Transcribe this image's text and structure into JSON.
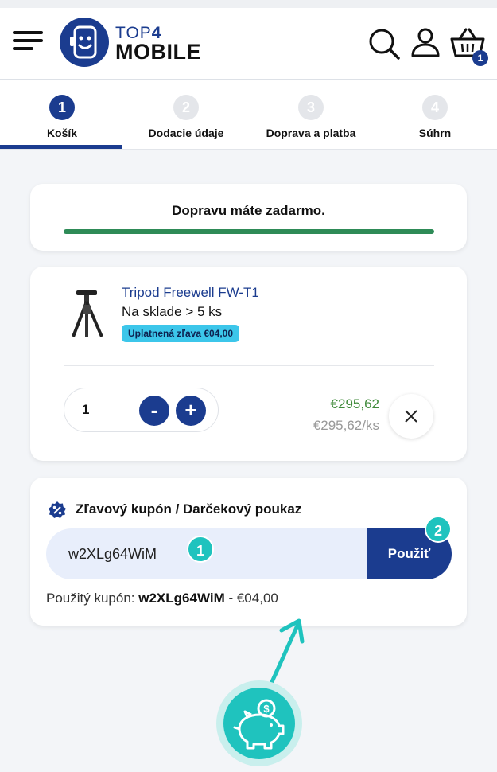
{
  "header": {
    "logo_top": "TOP",
    "logo_top_num": "4",
    "logo_main": "MOBILE",
    "cart_count": "1"
  },
  "steps": [
    {
      "num": "1",
      "label": "Košík",
      "active": true
    },
    {
      "num": "2",
      "label": "Dodacie údaje",
      "active": false
    },
    {
      "num": "3",
      "label": "Doprava a platba",
      "active": false
    },
    {
      "num": "4",
      "label": "Súhrn",
      "active": false
    }
  ],
  "shipping": {
    "text": "Dopravu máte zadarmo.",
    "progress": 1.0,
    "bar_color": "#2e8b57"
  },
  "product": {
    "name": "Tripod Freewell FW-T1",
    "stock": "Na sklade > 5 ks",
    "discount_badge": "Uplatnená zľava €04,00",
    "quantity": "1",
    "minus": "-",
    "plus": "+",
    "price": "€295,62",
    "unit_price": "€295,62/ks"
  },
  "coupon": {
    "title": "Zľavový kupón / Darčekový poukaz",
    "value": "w2XLg64WiM",
    "apply_label": "Použiť",
    "used_prefix": "Použitý kupón:",
    "used_code": "w2XLg64WiM",
    "used_suffix": "- €04,00"
  },
  "markers": {
    "one": "1",
    "two": "2"
  },
  "colors": {
    "brand": "#1b3c8f",
    "accent_teal": "#1fc3be",
    "badge_blue": "#3cc6ea",
    "price_green": "#3f8a3a"
  }
}
